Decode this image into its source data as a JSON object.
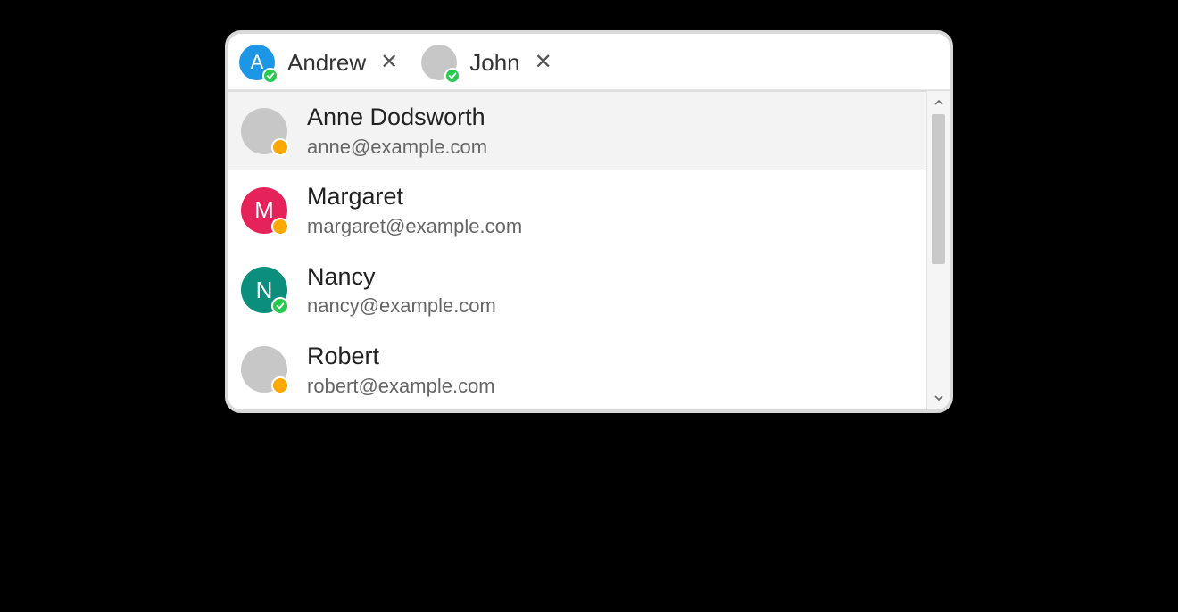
{
  "colors": {
    "blue": "#1e96e6",
    "pink": "#e6225b",
    "teal": "#0b8f7c",
    "grey": "#c7c7c7",
    "orange": "#ffa800",
    "green": "#28c94f"
  },
  "chips": [
    {
      "name": "Andrew",
      "avatar_letter": "A",
      "avatar_bg_key": "blue",
      "avatar_has_letter": true,
      "status": "available",
      "status_color_key": "green",
      "status_icon": "check"
    },
    {
      "name": "John",
      "avatar_letter": "",
      "avatar_bg_key": "grey",
      "avatar_has_letter": false,
      "status": "available",
      "status_color_key": "green",
      "status_icon": "check"
    }
  ],
  "suggestions": [
    {
      "name": "Anne Dodsworth",
      "email": "anne@example.com",
      "avatar_letter": "",
      "avatar_bg_key": "grey",
      "avatar_has_letter": false,
      "status": "away",
      "status_color_key": "orange",
      "status_icon": "dot",
      "highlighted": true
    },
    {
      "name": "Margaret",
      "email": "margaret@example.com",
      "avatar_letter": "M",
      "avatar_bg_key": "pink",
      "avatar_has_letter": true,
      "status": "away",
      "status_color_key": "orange",
      "status_icon": "dot",
      "highlighted": false
    },
    {
      "name": "Nancy",
      "email": "nancy@example.com",
      "avatar_letter": "N",
      "avatar_bg_key": "teal",
      "avatar_has_letter": true,
      "status": "available",
      "status_color_key": "green",
      "status_icon": "check",
      "highlighted": false
    },
    {
      "name": "Robert",
      "email": "robert@example.com",
      "avatar_letter": "",
      "avatar_bg_key": "grey",
      "avatar_has_letter": false,
      "status": "away",
      "status_color_key": "orange",
      "status_icon": "dot",
      "highlighted": false
    }
  ]
}
